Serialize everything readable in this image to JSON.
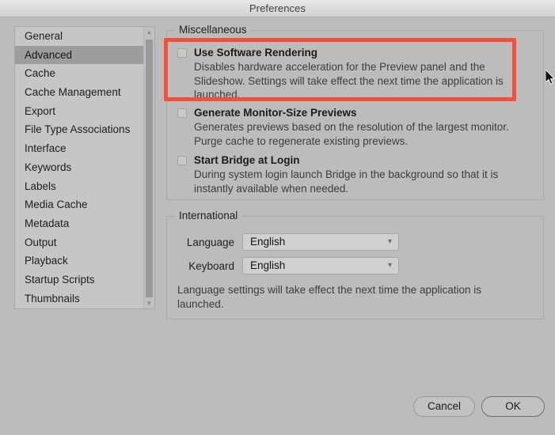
{
  "window": {
    "title": "Preferences"
  },
  "sidebar": {
    "items": [
      {
        "label": "General",
        "selected": false
      },
      {
        "label": "Advanced",
        "selected": true
      },
      {
        "label": "Cache",
        "selected": false
      },
      {
        "label": "Cache Management",
        "selected": false
      },
      {
        "label": "Export",
        "selected": false
      },
      {
        "label": "File Type Associations",
        "selected": false
      },
      {
        "label": "Interface",
        "selected": false
      },
      {
        "label": "Keywords",
        "selected": false
      },
      {
        "label": "Labels",
        "selected": false
      },
      {
        "label": "Media Cache",
        "selected": false
      },
      {
        "label": "Metadata",
        "selected": false
      },
      {
        "label": "Output",
        "selected": false
      },
      {
        "label": "Playback",
        "selected": false
      },
      {
        "label": "Startup Scripts",
        "selected": false
      },
      {
        "label": "Thumbnails",
        "selected": false
      }
    ],
    "scroll_up_icon": "chevron-up-icon",
    "scroll_down_icon": "chevron-down-icon"
  },
  "miscellaneous": {
    "group_title": "Miscellaneous",
    "options": [
      {
        "label": "Use Software Rendering",
        "checked": false,
        "description": "Disables hardware acceleration for the Preview panel and the Slideshow. Settings will take effect the next time the application is launched."
      },
      {
        "label": "Generate Monitor-Size Previews",
        "checked": false,
        "description": "Generates previews based on the resolution of the largest monitor. Purge cache to regenerate existing previews."
      },
      {
        "label": "Start Bridge at Login",
        "checked": false,
        "description": "During system login launch Bridge in the background so that it is instantly available when needed."
      }
    ]
  },
  "international": {
    "group_title": "International",
    "language_label": "Language",
    "language_value": "English",
    "keyboard_label": "Keyboard",
    "keyboard_value": "English",
    "note": "Language settings will take effect the next time the application is launched.",
    "chevron_icon": "chevron-down-icon"
  },
  "footer": {
    "cancel_label": "Cancel",
    "ok_label": "OK"
  },
  "annotation": {
    "highlight_color": "#f2503c",
    "target": "Use Software Rendering"
  },
  "colors": {
    "window_bg": "#bcbcbc",
    "titlebar_bg": "#dcdcdc",
    "list_bg": "#c6c6c6",
    "selected_row": "#9d9d9d",
    "accent_red": "#f2503c"
  }
}
